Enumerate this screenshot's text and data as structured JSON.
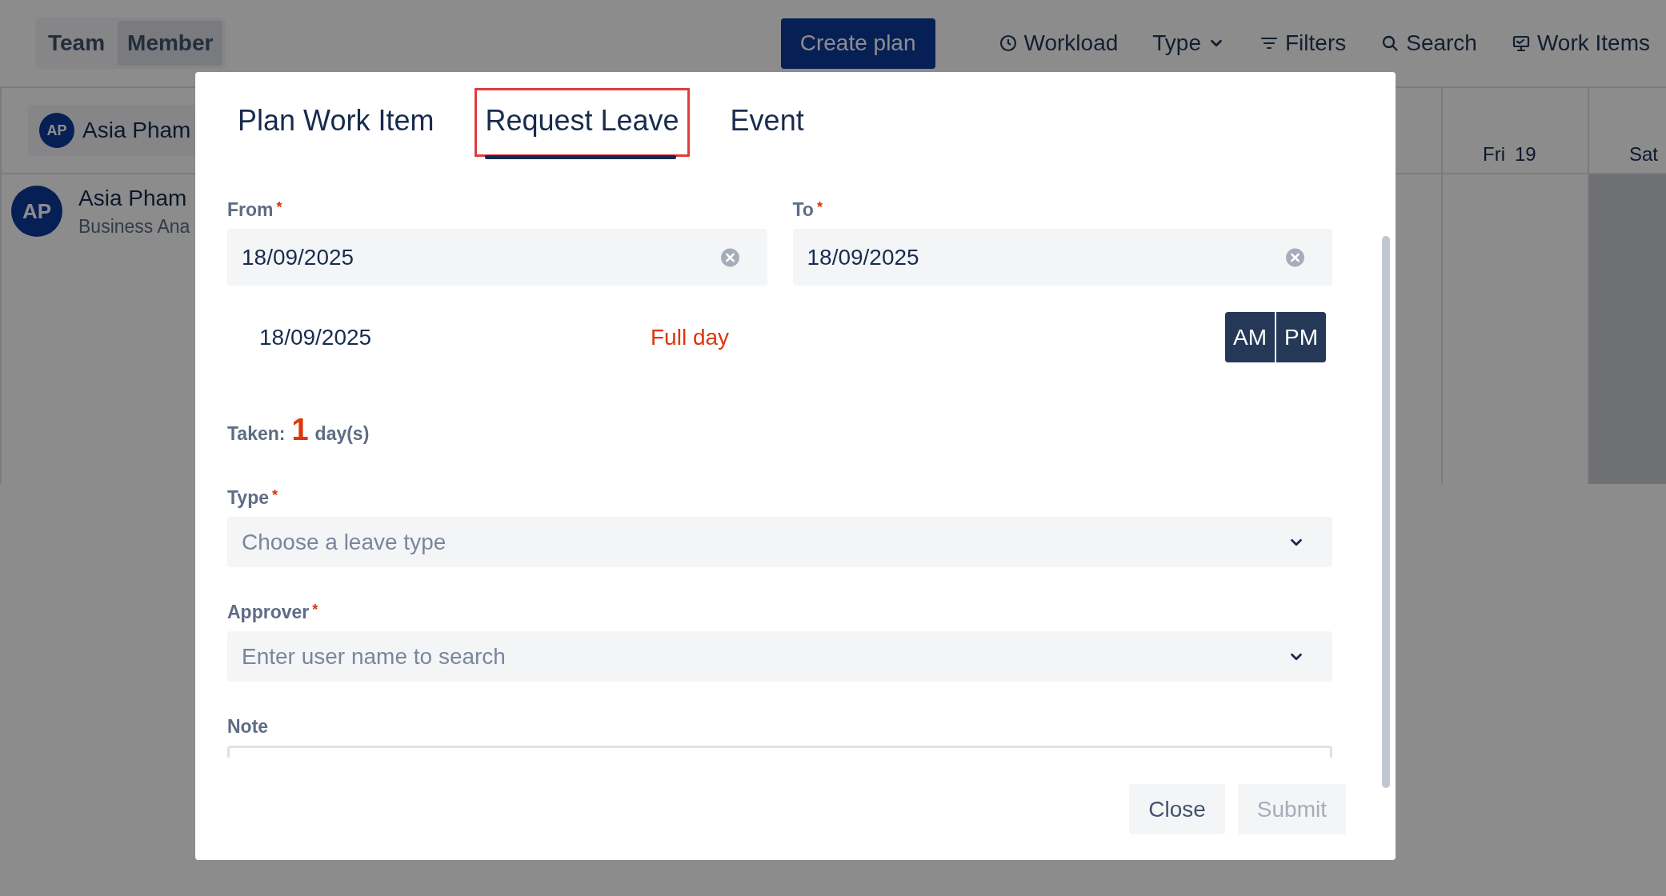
{
  "view_switch": [
    {
      "label": "Team",
      "selected": false
    },
    {
      "label": "Member",
      "selected": true
    }
  ],
  "toolbar": {
    "create_button": "Create plan",
    "items": [
      {
        "kind": "clock",
        "label": "Workload"
      },
      {
        "kind": "dropdown",
        "label": "Type"
      },
      {
        "kind": "filter",
        "label": "Filters"
      },
      {
        "kind": "search",
        "label": "Search"
      },
      {
        "kind": "monitor",
        "label": "Work Items"
      }
    ]
  },
  "member_chip": {
    "initials": "AP",
    "name": "Asia Pham"
  },
  "day_headers": [
    {
      "day": "Fri",
      "date": "19",
      "weekend": false
    },
    {
      "day": "Sat",
      "weekend": true
    }
  ],
  "members": [
    {
      "initials": "AP",
      "name": "Asia Pham",
      "role": "Business Ana"
    }
  ],
  "dialog": {
    "tabs": [
      {
        "label": "Plan Work Item",
        "selected": false,
        "highlighted": false
      },
      {
        "label": "Request Leave",
        "selected": true,
        "highlighted": true
      },
      {
        "label": "Event",
        "selected": false,
        "highlighted": false
      }
    ],
    "from": {
      "label": "From",
      "required_mark": "*",
      "value": "18/09/2025"
    },
    "to": {
      "label": "To",
      "required_mark": "*",
      "value": "18/09/2025"
    },
    "day_rows": [
      {
        "date": "18/09/2025",
        "duration": "Full day",
        "periods": [
          {
            "label": "AM",
            "selected": true
          },
          {
            "label": "PM",
            "selected": true
          }
        ]
      }
    ],
    "taken": {
      "label": "Taken:",
      "count": "1",
      "unit": "day(s)"
    },
    "type": {
      "label": "Type",
      "required_mark": "*",
      "placeholder": "Choose a leave type"
    },
    "approver": {
      "label": "Approver",
      "required_mark": "*",
      "placeholder": "Enter user name to search"
    },
    "note": {
      "label": "Note"
    },
    "buttons": [
      {
        "label": "Close",
        "disabled": false
      },
      {
        "label": "Submit",
        "disabled": true
      }
    ]
  }
}
